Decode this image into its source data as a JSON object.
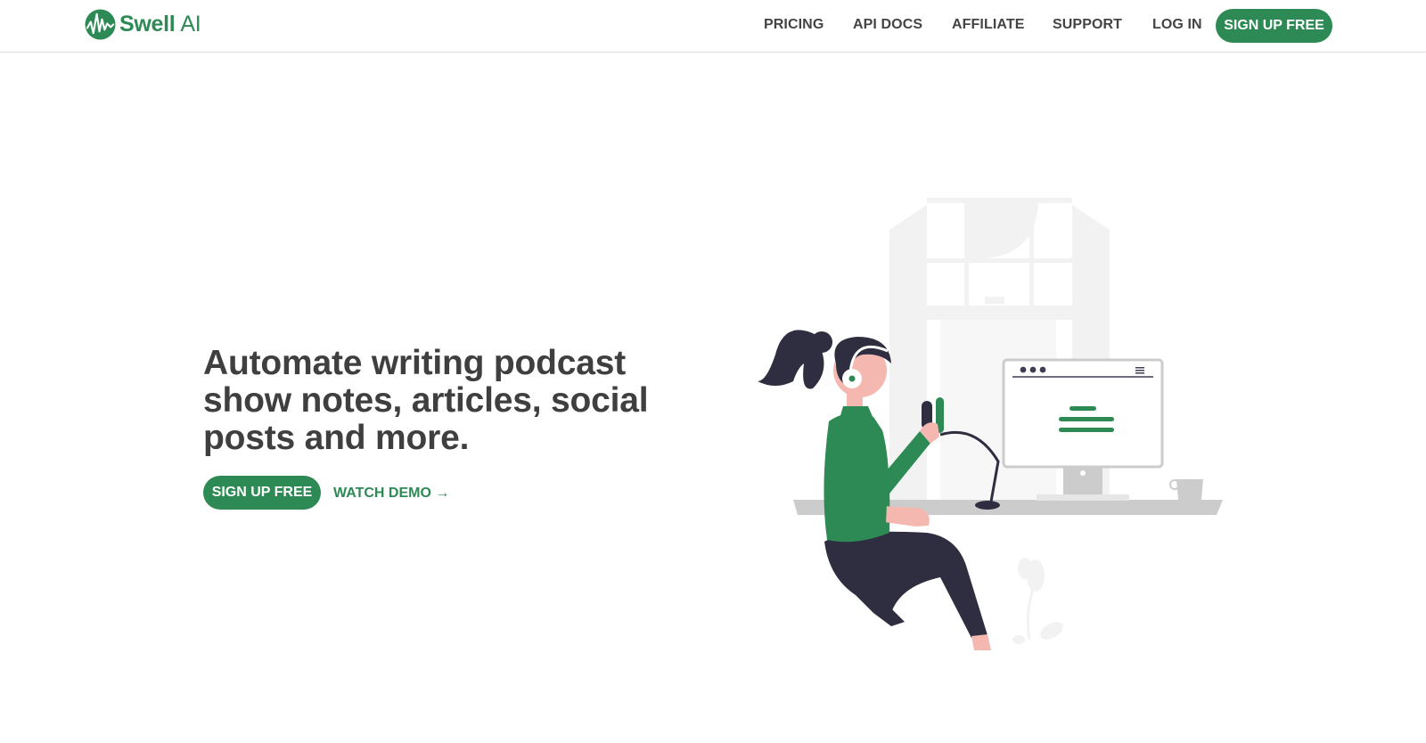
{
  "header": {
    "logo": {
      "brand_bold": "Swell",
      "brand_light": "AI"
    },
    "nav": {
      "pricing": "PRICING",
      "api_docs": "API DOCS",
      "affiliate": "AFFILIATE",
      "support": "SUPPORT",
      "login": "LOG IN",
      "signup": "SIGN UP FREE"
    }
  },
  "hero": {
    "title": "Automate writing podcast show notes, articles, social posts and more.",
    "primary_cta": "SIGN UP FREE",
    "secondary_cta": "WATCH DEMO →"
  },
  "colors": {
    "brand_green": "#2e8a54",
    "text_dark": "#3f3f3f",
    "figure_dark": "#2f2e41",
    "skin": "#f5b8b0",
    "light_gray": "#f2f2f2",
    "desk_gray": "#cccccc"
  },
  "icons": {
    "logo": "waveform-circle-logo",
    "illustration": "podcaster-at-desk-illustration"
  }
}
